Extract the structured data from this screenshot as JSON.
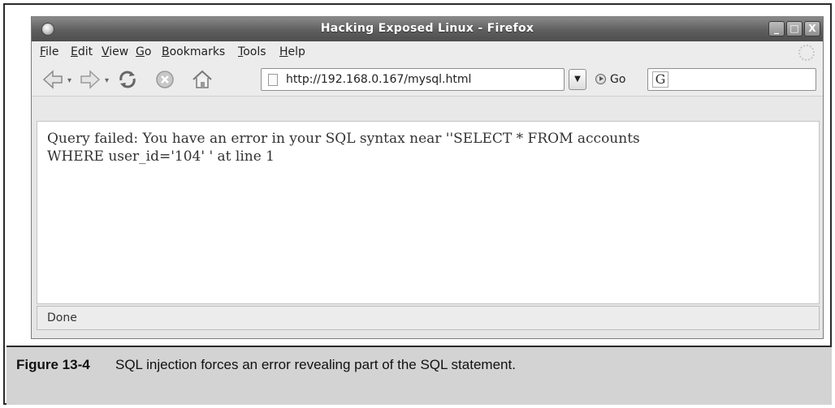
{
  "window": {
    "title": "Hacking Exposed Linux - Firefox",
    "controls": {
      "minimize": "_",
      "maximize": "□",
      "close": "X"
    }
  },
  "menu": {
    "items": [
      {
        "label": "File"
      },
      {
        "label": "Edit"
      },
      {
        "label": "View"
      },
      {
        "label": "Go"
      },
      {
        "label": "Bookmarks"
      },
      {
        "label": "Tools"
      },
      {
        "label": "Help"
      }
    ]
  },
  "toolbar": {
    "url": "http://192.168.0.167/mysql.html",
    "go_label": "Go",
    "search_engine_glyph": "G",
    "search_value": ""
  },
  "content": {
    "line1": "Query failed: You have an error in your SQL syntax near ''SELECT * FROM accounts",
    "line2": "WHERE user_id='104' ' at line 1"
  },
  "status": {
    "text": "Done"
  },
  "caption": {
    "label": "Figure 13-4",
    "text": "SQL injection forces an error revealing part of the SQL statement."
  }
}
